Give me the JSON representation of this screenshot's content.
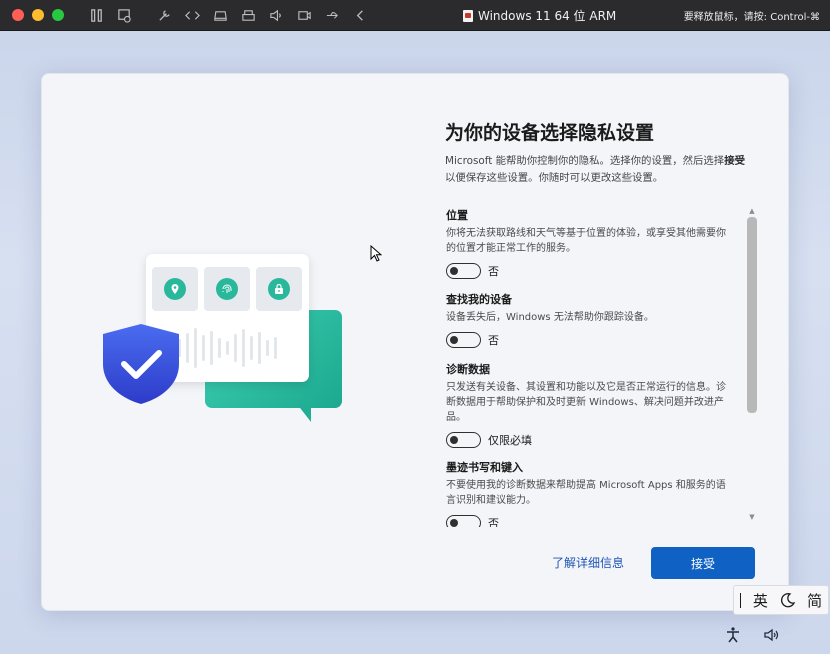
{
  "titlebar": {
    "title": "Windows 11 64 位 ARM",
    "hint": "要释放鼠标，请按: Control-⌘",
    "icons": [
      "pause-icon",
      "snapshot-icon",
      "settings-icon",
      "code-icon",
      "disk-icon",
      "printer-icon",
      "volume-icon",
      "camera-icon",
      "usb-icon",
      "back-icon"
    ]
  },
  "privacy": {
    "heading": "为你的设备选择隐私设置",
    "intro_part1": "Microsoft 能帮助你控制你的隐私。选择你的设置，然后选择",
    "intro_bold": "接受",
    "intro_part2": "以便保存这些设置。你随时可以更改这些设置。",
    "settings": [
      {
        "title": "位置",
        "desc": "你将无法获取路线和天气等基于位置的体验，或享受其他需要你的位置才能正常工作的服务。",
        "toggle_label": "否"
      },
      {
        "title": "查找我的设备",
        "desc": "设备丢失后，Windows 无法帮助你跟踪设备。",
        "toggle_label": "否"
      },
      {
        "title": "诊断数据",
        "desc": "只发送有关设备、其设置和功能以及它是否正常运行的信息。诊断数据用于帮助保护和及时更新 Windows、解决问题并改进产品。",
        "toggle_label": "仅限必填"
      },
      {
        "title": "墨迹书写和键入",
        "desc": "不要使用我的诊断数据来帮助提高 Microsoft Apps 和服务的语言识别和建议能力。",
        "toggle_label": "否"
      }
    ],
    "learn_more": "了解详细信息",
    "accept": "接受"
  },
  "ime": {
    "mode": "英",
    "layout": "简"
  },
  "colors": {
    "accent": "#0f62c4",
    "link": "#1f55b5",
    "illustration_green": "#2ab89c",
    "shield_blue": "#3a55d8"
  }
}
